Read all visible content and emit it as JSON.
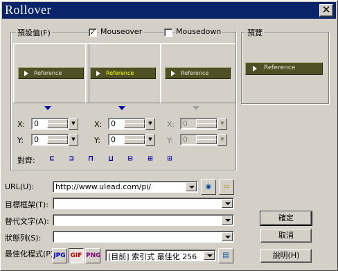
{
  "window": {
    "title": "Rollover"
  },
  "groups": {
    "default_label": "預設值(F)",
    "mouseover_label": "Mouseover",
    "mousedown_label": "Mousedown",
    "preview_label": "預覽"
  },
  "checks": {
    "mouseover": true,
    "mousedown": false
  },
  "states": [
    {
      "name": "default",
      "button_text": "Reference",
      "x": "0",
      "y": "0",
      "enabled": true
    },
    {
      "name": "mouseover",
      "button_text": "Reference",
      "x": "0",
      "y": "0",
      "enabled": true
    },
    {
      "name": "mousedown",
      "button_text": "Reference",
      "x": "0",
      "y": "0",
      "enabled": false
    }
  ],
  "coord_labels": {
    "x": "X:",
    "y": "Y:"
  },
  "align_label": "對齊:",
  "preview": {
    "button_text": "Reference"
  },
  "fields": {
    "url_label": "URL(U):",
    "url_value": "http://www.ulead.com/pi/",
    "target_label": "目標框架(T):",
    "target_value": "",
    "alt_label": "替代文字(A):",
    "alt_value": "",
    "status_label": "狀態列(S):",
    "status_value": "",
    "optimize_label": "最佳化程式(P):",
    "optimize_value": "[目前] 索引式 最佳化 256"
  },
  "format_buttons": [
    "JPG",
    "GIF",
    "PNG"
  ],
  "buttons": {
    "ok": "確定",
    "cancel": "取消",
    "help": "說明(H)"
  },
  "colors": {
    "titlebar": "#0a246a",
    "face": "#d4d0c8",
    "ref_button": "#4f5125",
    "accent_arrow": "#0000a0"
  }
}
